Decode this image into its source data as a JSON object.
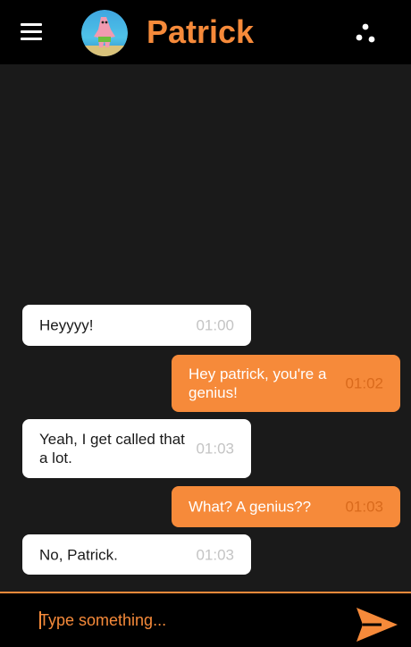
{
  "header": {
    "title": "Patrick",
    "menu_icon": "hamburger-menu-icon",
    "more_icon": "more-options-icon",
    "avatar_alt": "avatar"
  },
  "messages": [
    {
      "direction": "incoming",
      "text": "Heyyyy!",
      "time": "01:00"
    },
    {
      "direction": "outgoing",
      "text": "Hey patrick, you're a genius!",
      "time": "01:02"
    },
    {
      "direction": "incoming",
      "text": "Yeah, I get called that a lot.",
      "time": "01:03"
    },
    {
      "direction": "outgoing",
      "text": "What? A genius??",
      "time": "01:03"
    },
    {
      "direction": "incoming",
      "text": "No, Patrick.",
      "time": "01:03"
    }
  ],
  "composer": {
    "placeholder": "Type something...",
    "value": "",
    "send_icon": "send-icon"
  },
  "colors": {
    "accent": "#f68a3a",
    "background": "#1a1a1a",
    "header_bg": "#000000",
    "incoming_bubble": "#ffffff",
    "outgoing_bubble": "#f68a3a"
  }
}
